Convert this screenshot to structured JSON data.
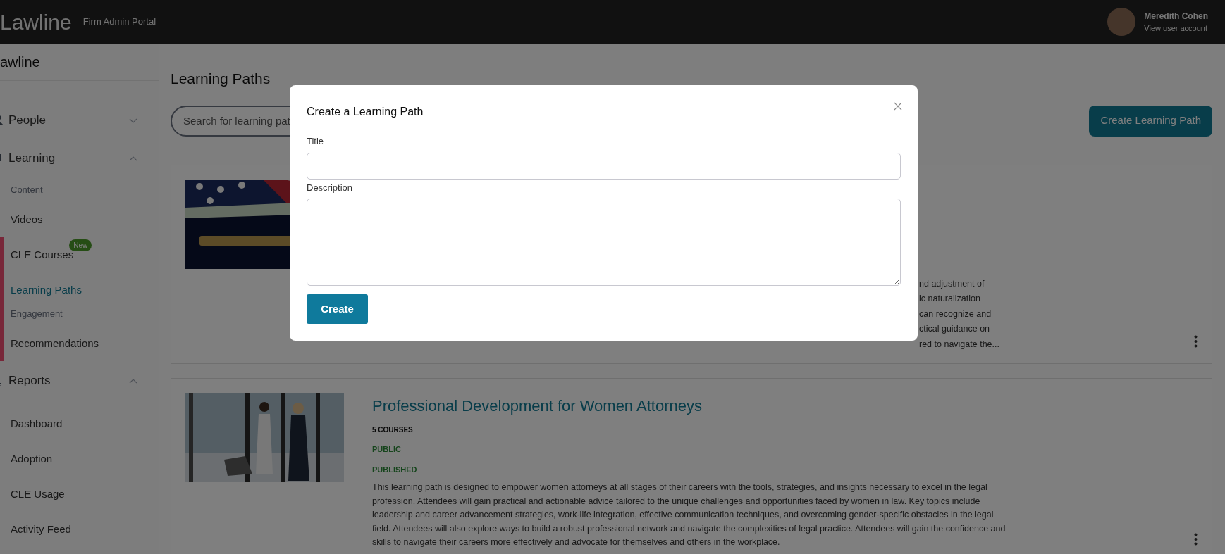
{
  "topbar": {
    "logo": "Lawline",
    "portal": "Firm Admin Portal",
    "user": {
      "name": "Meredith Cohen",
      "link": "View user account"
    }
  },
  "sidebar": {
    "brand": "awline",
    "groups": [
      {
        "label": "People",
        "expanded": false
      },
      {
        "label": "Learning",
        "expanded": true,
        "items": [
          {
            "kind": "section",
            "label": "Content"
          },
          {
            "kind": "link",
            "label": "Videos",
            "selected": false
          },
          {
            "kind": "link",
            "label": "CLE Courses",
            "selected": false,
            "badge": "New"
          },
          {
            "kind": "link",
            "label": "Learning Paths",
            "selected": true
          },
          {
            "kind": "section",
            "label": "Engagement"
          },
          {
            "kind": "link",
            "label": "Recommendations",
            "selected": false
          }
        ]
      },
      {
        "label": "Reports",
        "expanded": true,
        "items": [
          {
            "kind": "link",
            "label": "Dashboard",
            "selected": false
          },
          {
            "kind": "link",
            "label": "Adoption",
            "selected": false
          },
          {
            "kind": "link",
            "label": "CLE Usage",
            "selected": false
          },
          {
            "kind": "link",
            "label": "Activity Feed",
            "selected": false
          }
        ]
      }
    ]
  },
  "page": {
    "title": "Learning Paths",
    "search": {
      "placeholder": "Search for learning pat"
    },
    "create_button": "Create Learning Path",
    "cards": [
      {
        "description_lines": [
          "nd adjustment of",
          "ic naturalization",
          "can recognize and",
          "ctical guidance on",
          "red to navigate the..."
        ]
      },
      {
        "title": "Professional Development for Women Attorneys",
        "courses": "5 COURSES",
        "visibility": "PUBLIC",
        "status": "PUBLISHED",
        "description": "This learning path is designed to empower women attorneys at all stages of their careers with the tools, strategies, and insights necessary to excel in the legal profession. Attendees will gain practical and actionable advice tailored to the unique challenges and opportunities faced by women in law. Key topics include leadership and career advancement strategies, work-life integration, effective communication techniques, and overcoming gender-specific obstacles in the legal field. Attendees will also explore ways to build a robust professional network and navigate the complexities of legal practice. Attendees will gain the confidence and skills to navigate their careers more effectively and advocate for themselves and others in the workplace."
      }
    ]
  },
  "modal": {
    "title": "Create a Learning Path",
    "fields": [
      {
        "kind": "input",
        "label": "Title"
      },
      {
        "kind": "textarea",
        "label": "Description"
      }
    ],
    "submit": "Create"
  }
}
